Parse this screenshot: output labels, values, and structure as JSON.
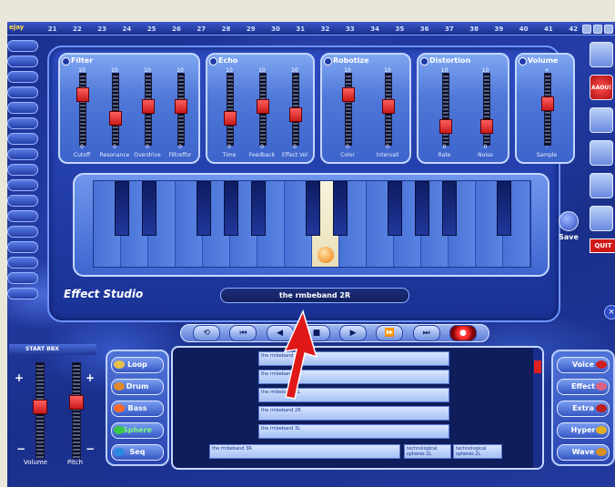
{
  "track_numbers": [
    "21",
    "22",
    "23",
    "24",
    "25",
    "26",
    "27",
    "28",
    "29",
    "30",
    "31",
    "32",
    "33",
    "34",
    "35",
    "36",
    "37",
    "38",
    "39",
    "40",
    "41",
    "42"
  ],
  "effect_groups": [
    {
      "title": "Filter",
      "sliders": [
        {
          "label": "Cutoff",
          "top": "10",
          "bot": "0",
          "level": 0.75
        },
        {
          "label": "Resonance",
          "top": "10",
          "bot": "0",
          "level": 0.35
        },
        {
          "label": "Overdrive",
          "top": "10",
          "bot": "0",
          "level": 0.55
        },
        {
          "label": "Filtreffor",
          "top": "10",
          "bot": "0",
          "level": 0.55
        }
      ]
    },
    {
      "title": "Echo",
      "sliders": [
        {
          "label": "Time",
          "top": "10",
          "bot": "0",
          "level": 0.35
        },
        {
          "label": "Feedback",
          "top": "10",
          "bot": "0",
          "level": 0.55
        },
        {
          "label": "Effect Vol",
          "top": "10",
          "bot": "0",
          "level": 0.4
        }
      ]
    },
    {
      "title": "Robotize",
      "sliders": [
        {
          "label": "Color",
          "top": "10",
          "bot": "0",
          "level": 0.75
        },
        {
          "label": "Intervall",
          "top": "10",
          "bot": "0",
          "level": 0.55
        }
      ]
    },
    {
      "title": "Distortion",
      "sliders": [
        {
          "label": "Rate",
          "top": "10",
          "bot": "0",
          "level": 0.2
        },
        {
          "label": "Noise",
          "top": "10",
          "bot": "0",
          "level": 0.2
        }
      ]
    },
    {
      "title": "Volume",
      "sliders": [
        {
          "label": "Sample",
          "top": "+",
          "bot": "-",
          "level": 0.6
        }
      ]
    }
  ],
  "panel_title": "Effect Studio",
  "sample_name": "the rmbeband 2R",
  "save_label": "Save",
  "quit_label": "QUIT",
  "right_icons": [
    "grid-icon",
    "aaah-icon",
    "timer-icon",
    "disk-icon",
    "star-icon",
    "tool-icon"
  ],
  "transport": [
    "loop",
    "prev",
    "rewind",
    "stop",
    "play",
    "forward",
    "next",
    "record"
  ],
  "start_label": "START BBX",
  "volume_label": "Volume",
  "pitch_label": "Pitch",
  "levels": {
    "volume": 0.55,
    "pitch": 0.6
  },
  "left_styles": [
    {
      "label": "Loop",
      "color": "#e6c24a"
    },
    {
      "label": "Drum",
      "color": "#e08a2a"
    },
    {
      "label": "Bass",
      "color": "#ff6a2a"
    },
    {
      "label": "Sphere",
      "color": "#38c848",
      "selected": true
    },
    {
      "label": "Seq",
      "color": "#2a8ae0"
    }
  ],
  "right_styles": [
    {
      "label": "Voice",
      "color": "#d02020"
    },
    {
      "label": "Effect",
      "color": "#e06080"
    },
    {
      "label": "Extra",
      "color": "#c02020"
    },
    {
      "label": "Hyper",
      "color": "#e0b020"
    },
    {
      "label": "Wave",
      "color": "#d89020"
    }
  ],
  "lanes": [
    {
      "text": "the rmbeband 1L"
    },
    {
      "text": "the rmbeband 1R"
    },
    {
      "text": "the rmbeband 2L"
    },
    {
      "text": "the rmbeband 2R"
    },
    {
      "text": "the rmbeband 3L"
    },
    {
      "text": "the rmbeband 3R"
    },
    {
      "text": "technological spheres 1L"
    },
    {
      "text": "technological spheres 2L"
    }
  ]
}
